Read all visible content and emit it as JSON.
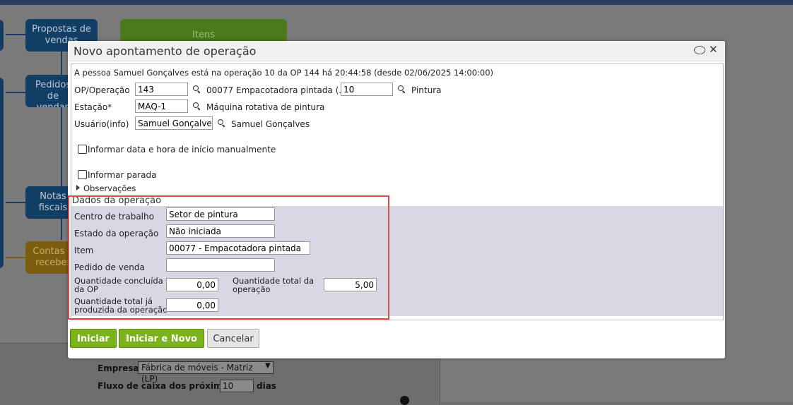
{
  "background": {
    "flow": {
      "propostas": "Propostas de vendas",
      "itens": "Itens",
      "pedidos": "Pedidos de vendas",
      "notas": "Notas fiscais",
      "contas": "Contas a receber"
    },
    "empresa_label": "Empresa",
    "empresa_value": "Fábrica de móveis - Matriz (LP)",
    "fluxo_label": "Fluxo de caixa dos próximos",
    "fluxo_value": "10",
    "fluxo_unit": "dias"
  },
  "dialog": {
    "title": "Novo apontamento de operação",
    "info": "A pessoa Samuel Gonçalves está na operação 10 da OP 144 há 20:44:58 (desde 02/06/2025 14:00:00)",
    "op_label": "OP/Operação",
    "op_value": "143",
    "op_desc": "00077 Empacotadora pintada (...",
    "operacao_value": "10",
    "operacao_desc": "Pintura",
    "estacao_label": "Estação*",
    "estacao_value": "MAQ-1",
    "estacao_desc": "Máquina rotativa de pintura",
    "usuario_label": "Usuário(info)",
    "usuario_value": "Samuel Gonçalves",
    "usuario_desc": "Samuel Gonçalves",
    "check_data_label": "Informar data e hora de início manualmente",
    "check_parada_label": "Informar parada",
    "observacoes_label": "Observações",
    "section": {
      "title": "Dados da operação",
      "centro_label": "Centro de trabalho",
      "centro_value": "Setor de pintura",
      "estado_label": "Estado da operação",
      "estado_value": "Não iniciada",
      "item_label": "Item",
      "item_value": "00077 - Empacotadora pintada",
      "pedido_label": "Pedido de venda",
      "pedido_value": "",
      "qtd_concluida_label_1": "Quantidade concluída",
      "qtd_concluida_label_2": "da OP",
      "qtd_concluida_value": "0,00",
      "qtd_total_label_1": "Quantidade total da",
      "qtd_total_label_2": "operação",
      "qtd_total_value": "5,00",
      "qtd_produzida_label_1": "Quantidade total já",
      "qtd_produzida_label_2": "produzida da operação",
      "qtd_produzida_value": "0,00"
    },
    "buttons": {
      "iniciar": "Iniciar",
      "iniciar_novo": "Iniciar e Novo",
      "cancelar": "Cancelar"
    }
  }
}
